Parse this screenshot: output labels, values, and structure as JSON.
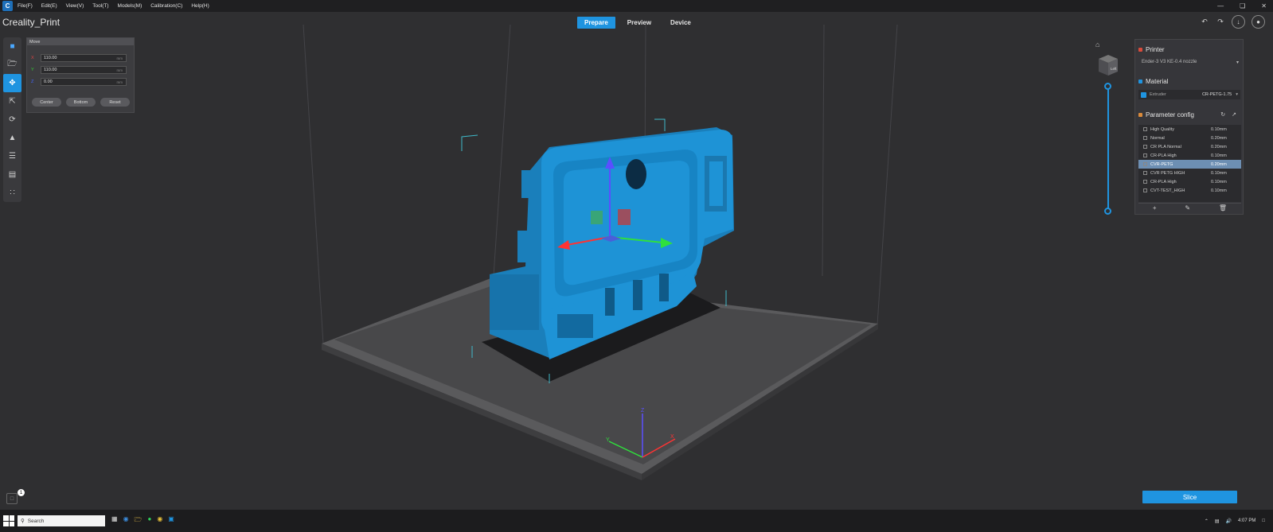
{
  "menubar": {
    "items": [
      "File(F)",
      "Edit(E)",
      "View(V)",
      "Tool(T)",
      "Models(M)",
      "Calibration(C)",
      "Help(H)"
    ]
  },
  "app_title": "Creality_Print",
  "mode_tabs": [
    "Prepare",
    "Preview",
    "Device"
  ],
  "move_panel": {
    "title": "Move",
    "x_value": "110.00",
    "y_value": "110.00",
    "z_value": "0.00",
    "unit": "mm",
    "buttons": [
      "Center",
      "Bottom",
      "Reset"
    ]
  },
  "printer": {
    "title": "Printer",
    "selected": "Ender-3 V3 KE-0.4 nozzle"
  },
  "material": {
    "title": "Material",
    "extruder_label": "Extruder",
    "selected": "CR-PETG-1.75"
  },
  "parameter_config": {
    "title": "Parameter config",
    "profiles": [
      {
        "name": "High Quality",
        "value": "0.10mm"
      },
      {
        "name": "Normal",
        "value": "0.20mm"
      },
      {
        "name": "CR PLA Normal",
        "value": "0.20mm"
      },
      {
        "name": "CR-PLA High",
        "value": "0.10mm"
      },
      {
        "name": "CVR-PETG",
        "value": "0.20mm"
      },
      {
        "name": "CVR PETG HIGH",
        "value": "0.10mm"
      },
      {
        "name": "CR-PLA High",
        "value": "0.10mm"
      },
      {
        "name": "CVT-TEST_HIGH",
        "value": "0.10mm"
      }
    ],
    "selected_index": 4
  },
  "slice_label": "Slice",
  "view_cube_label": "Left",
  "notification_count": "1",
  "taskbar": {
    "search_placeholder": "Search",
    "clock": "4:07 PM"
  },
  "axes": {
    "x": "X",
    "y": "Y",
    "z": "Z"
  },
  "colors": {
    "accent": "#1f94e0",
    "model": "#1e93d6",
    "background": "#2f2f31"
  }
}
